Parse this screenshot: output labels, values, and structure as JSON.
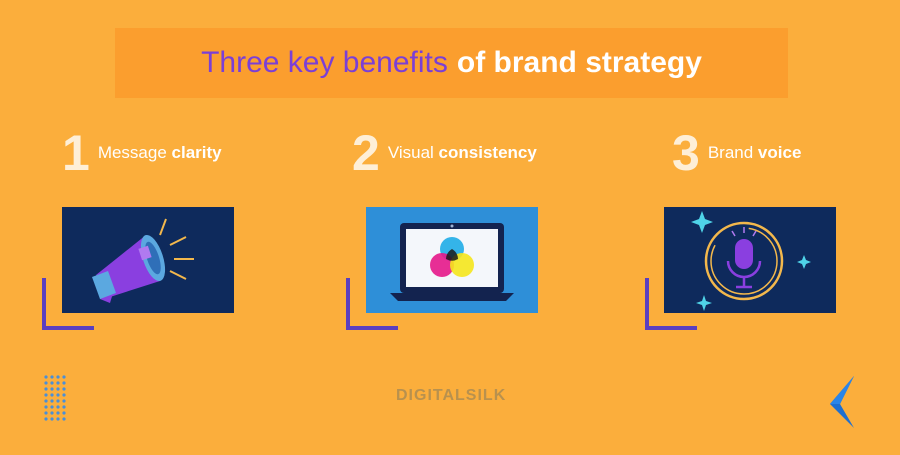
{
  "title": {
    "part1": "Three key benefits",
    "part2": "of brand strategy"
  },
  "benefits": [
    {
      "number": "1",
      "label_regular": "Message",
      "label_bold": "clarity",
      "icon": "megaphone-icon"
    },
    {
      "number": "2",
      "label_regular": "Visual",
      "label_bold": "consistency",
      "icon": "laptop-color-icon"
    },
    {
      "number": "3",
      "label_regular": "Brand",
      "label_bold": "voice",
      "icon": "microphone-icon"
    }
  ],
  "brand": "DIGITALSILK",
  "colors": {
    "background": "#FBAE3C",
    "banner": "#FB9E2E",
    "title_accent": "#7B3FD6",
    "card_navy": "#0E2A5C",
    "card_blue": "#2E8FD8",
    "bracket": "#5A3FBF"
  }
}
